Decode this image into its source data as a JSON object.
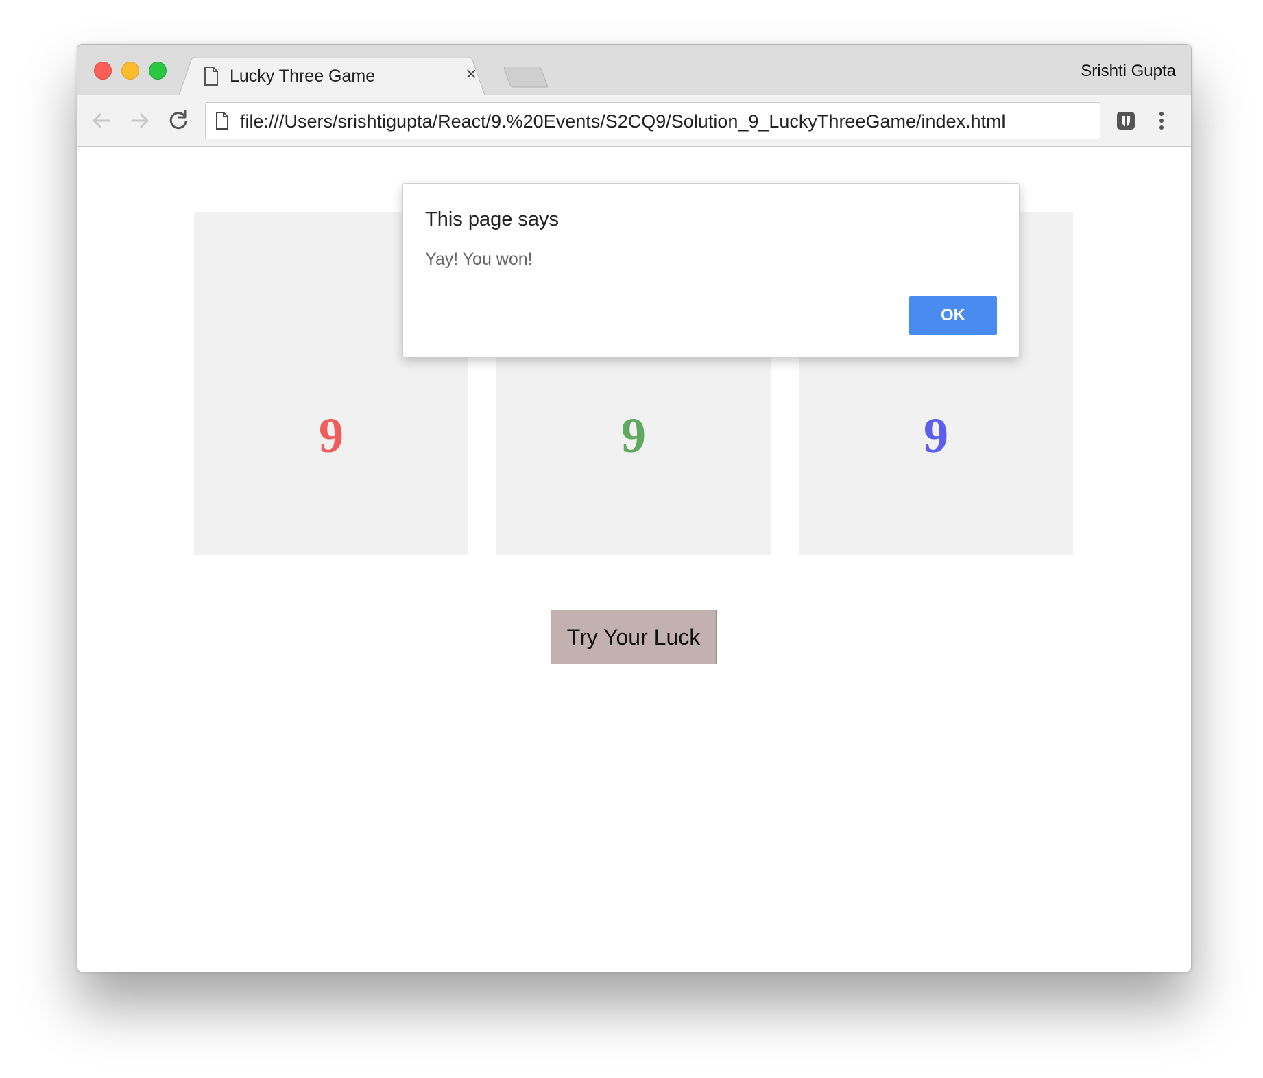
{
  "window": {
    "profile_name": "Srishti Gupta",
    "traffic_lights": {
      "close": "#fc5f57",
      "minimize": "#fdbc2e",
      "maximize": "#29c840"
    }
  },
  "tabs": [
    {
      "title": "Lucky Three Game",
      "icon": "document-icon",
      "close_label": "×",
      "active": true
    }
  ],
  "toolbar": {
    "back_icon": "arrow-left-icon",
    "forward_icon": "arrow-right-icon",
    "reload_icon": "reload-icon",
    "url": "file:///Users/srishtigupta/React/9.%20Events/S2CQ9/Solution_9_LuckyThreeGame/index.html",
    "extension_icon": "bitwarden-shield-icon",
    "menu_icon": "kebab-menu-icon"
  },
  "game": {
    "cards": [
      {
        "value": "9",
        "color": "#ef5d5d"
      },
      {
        "value": "9",
        "color": "#5faa5f"
      },
      {
        "value": "9",
        "color": "#5d5df0"
      }
    ],
    "card_background": "#f1f1f1",
    "button_label": "Try Your Luck",
    "button_color": "#c3b1b1"
  },
  "alert": {
    "title": "This page says",
    "message": "Yay! You won!",
    "ok_label": "OK",
    "ok_color": "#4a8bef"
  }
}
